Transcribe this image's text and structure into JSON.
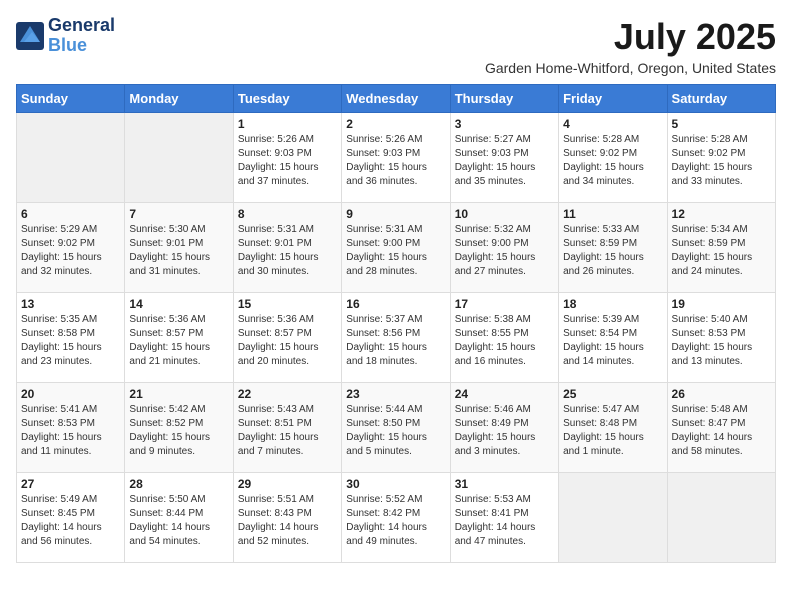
{
  "header": {
    "logo_line1": "General",
    "logo_line2": "Blue",
    "month_year": "July 2025",
    "location": "Garden Home-Whitford, Oregon, United States"
  },
  "weekdays": [
    "Sunday",
    "Monday",
    "Tuesday",
    "Wednesday",
    "Thursday",
    "Friday",
    "Saturday"
  ],
  "weeks": [
    [
      {
        "day": "",
        "info": ""
      },
      {
        "day": "",
        "info": ""
      },
      {
        "day": "1",
        "info": "Sunrise: 5:26 AM\nSunset: 9:03 PM\nDaylight: 15 hours\nand 37 minutes."
      },
      {
        "day": "2",
        "info": "Sunrise: 5:26 AM\nSunset: 9:03 PM\nDaylight: 15 hours\nand 36 minutes."
      },
      {
        "day": "3",
        "info": "Sunrise: 5:27 AM\nSunset: 9:03 PM\nDaylight: 15 hours\nand 35 minutes."
      },
      {
        "day": "4",
        "info": "Sunrise: 5:28 AM\nSunset: 9:02 PM\nDaylight: 15 hours\nand 34 minutes."
      },
      {
        "day": "5",
        "info": "Sunrise: 5:28 AM\nSunset: 9:02 PM\nDaylight: 15 hours\nand 33 minutes."
      }
    ],
    [
      {
        "day": "6",
        "info": "Sunrise: 5:29 AM\nSunset: 9:02 PM\nDaylight: 15 hours\nand 32 minutes."
      },
      {
        "day": "7",
        "info": "Sunrise: 5:30 AM\nSunset: 9:01 PM\nDaylight: 15 hours\nand 31 minutes."
      },
      {
        "day": "8",
        "info": "Sunrise: 5:31 AM\nSunset: 9:01 PM\nDaylight: 15 hours\nand 30 minutes."
      },
      {
        "day": "9",
        "info": "Sunrise: 5:31 AM\nSunset: 9:00 PM\nDaylight: 15 hours\nand 28 minutes."
      },
      {
        "day": "10",
        "info": "Sunrise: 5:32 AM\nSunset: 9:00 PM\nDaylight: 15 hours\nand 27 minutes."
      },
      {
        "day": "11",
        "info": "Sunrise: 5:33 AM\nSunset: 8:59 PM\nDaylight: 15 hours\nand 26 minutes."
      },
      {
        "day": "12",
        "info": "Sunrise: 5:34 AM\nSunset: 8:59 PM\nDaylight: 15 hours\nand 24 minutes."
      }
    ],
    [
      {
        "day": "13",
        "info": "Sunrise: 5:35 AM\nSunset: 8:58 PM\nDaylight: 15 hours\nand 23 minutes."
      },
      {
        "day": "14",
        "info": "Sunrise: 5:36 AM\nSunset: 8:57 PM\nDaylight: 15 hours\nand 21 minutes."
      },
      {
        "day": "15",
        "info": "Sunrise: 5:36 AM\nSunset: 8:57 PM\nDaylight: 15 hours\nand 20 minutes."
      },
      {
        "day": "16",
        "info": "Sunrise: 5:37 AM\nSunset: 8:56 PM\nDaylight: 15 hours\nand 18 minutes."
      },
      {
        "day": "17",
        "info": "Sunrise: 5:38 AM\nSunset: 8:55 PM\nDaylight: 15 hours\nand 16 minutes."
      },
      {
        "day": "18",
        "info": "Sunrise: 5:39 AM\nSunset: 8:54 PM\nDaylight: 15 hours\nand 14 minutes."
      },
      {
        "day": "19",
        "info": "Sunrise: 5:40 AM\nSunset: 8:53 PM\nDaylight: 15 hours\nand 13 minutes."
      }
    ],
    [
      {
        "day": "20",
        "info": "Sunrise: 5:41 AM\nSunset: 8:53 PM\nDaylight: 15 hours\nand 11 minutes."
      },
      {
        "day": "21",
        "info": "Sunrise: 5:42 AM\nSunset: 8:52 PM\nDaylight: 15 hours\nand 9 minutes."
      },
      {
        "day": "22",
        "info": "Sunrise: 5:43 AM\nSunset: 8:51 PM\nDaylight: 15 hours\nand 7 minutes."
      },
      {
        "day": "23",
        "info": "Sunrise: 5:44 AM\nSunset: 8:50 PM\nDaylight: 15 hours\nand 5 minutes."
      },
      {
        "day": "24",
        "info": "Sunrise: 5:46 AM\nSunset: 8:49 PM\nDaylight: 15 hours\nand 3 minutes."
      },
      {
        "day": "25",
        "info": "Sunrise: 5:47 AM\nSunset: 8:48 PM\nDaylight: 15 hours\nand 1 minute."
      },
      {
        "day": "26",
        "info": "Sunrise: 5:48 AM\nSunset: 8:47 PM\nDaylight: 14 hours\nand 58 minutes."
      }
    ],
    [
      {
        "day": "27",
        "info": "Sunrise: 5:49 AM\nSunset: 8:45 PM\nDaylight: 14 hours\nand 56 minutes."
      },
      {
        "day": "28",
        "info": "Sunrise: 5:50 AM\nSunset: 8:44 PM\nDaylight: 14 hours\nand 54 minutes."
      },
      {
        "day": "29",
        "info": "Sunrise: 5:51 AM\nSunset: 8:43 PM\nDaylight: 14 hours\nand 52 minutes."
      },
      {
        "day": "30",
        "info": "Sunrise: 5:52 AM\nSunset: 8:42 PM\nDaylight: 14 hours\nand 49 minutes."
      },
      {
        "day": "31",
        "info": "Sunrise: 5:53 AM\nSunset: 8:41 PM\nDaylight: 14 hours\nand 47 minutes."
      },
      {
        "day": "",
        "info": ""
      },
      {
        "day": "",
        "info": ""
      }
    ]
  ]
}
